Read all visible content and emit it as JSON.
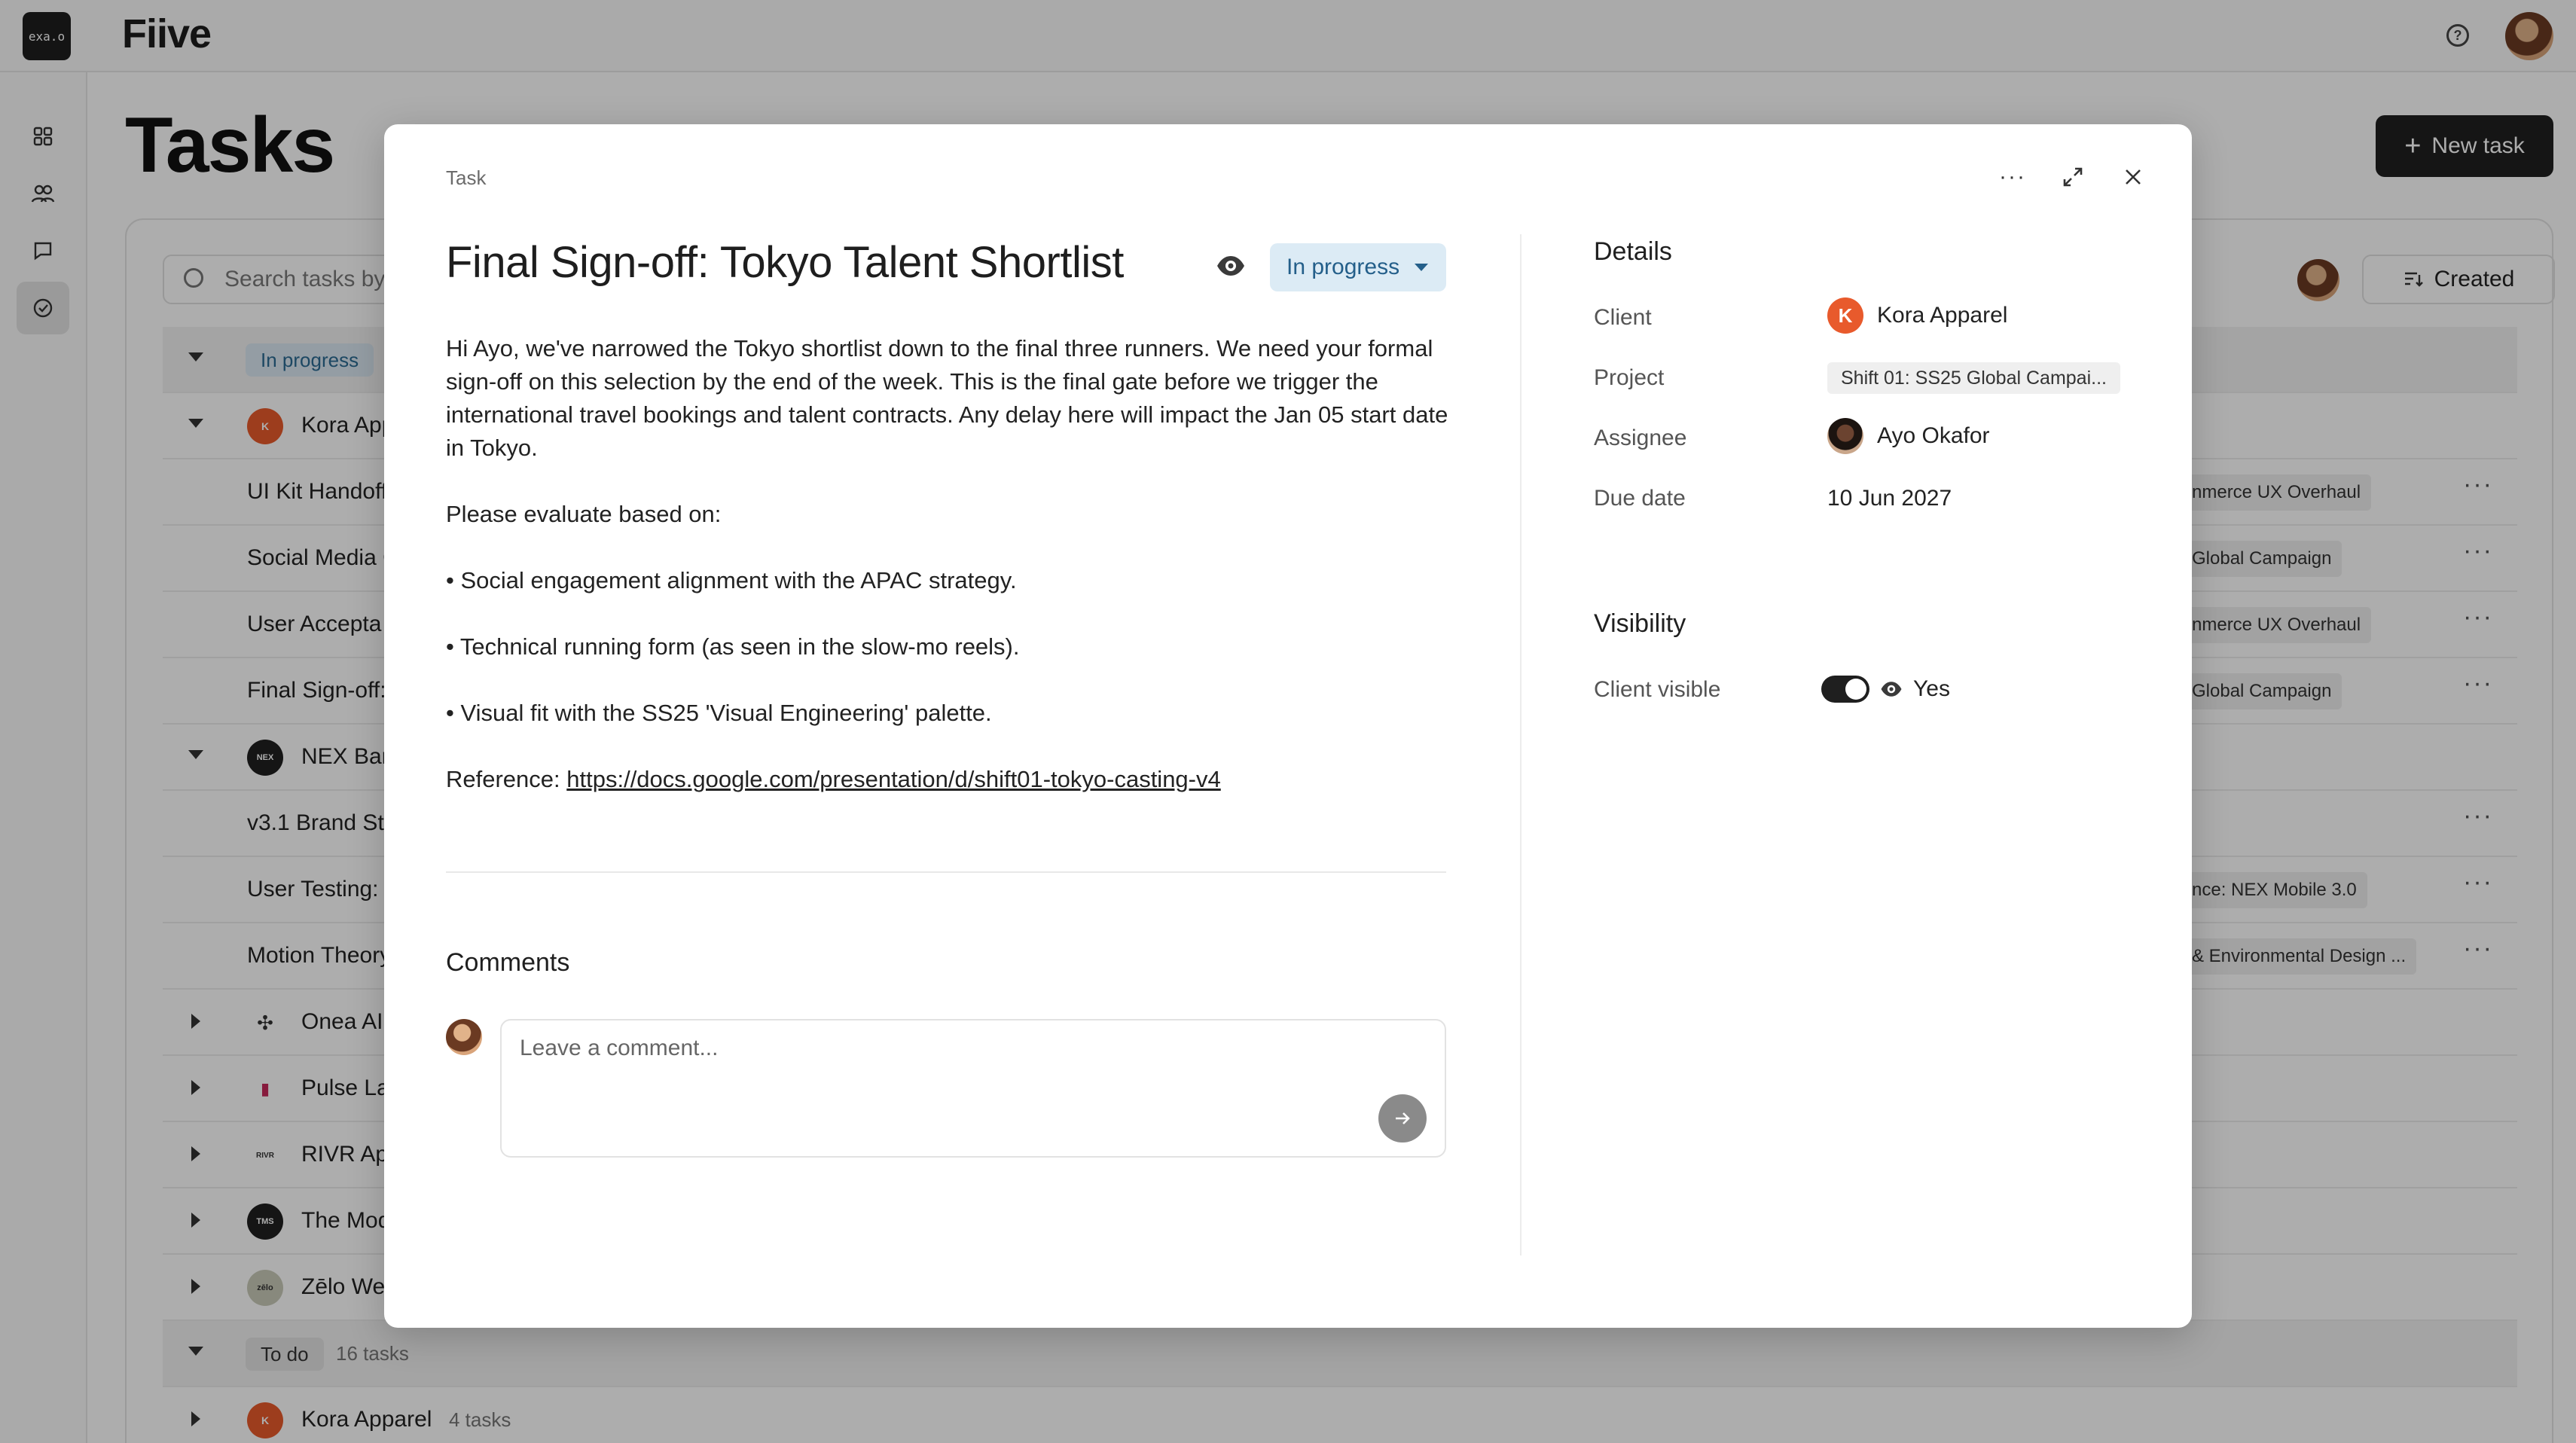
{
  "app": {
    "org_logo_text": "exa.o",
    "brand": "Fiive",
    "help_icon": "help-circle-icon"
  },
  "page": {
    "title": "Tasks",
    "new_task_label": "New task",
    "search_placeholder": "Search tasks by",
    "sort_label": "Created"
  },
  "list": {
    "groups": [
      {
        "status": "In progress"
      },
      {
        "status": "To do",
        "count": "16 tasks"
      }
    ],
    "rows": [
      {
        "kind": "client",
        "name": "Kora App",
        "logo": "K",
        "color": "#e85a2c"
      },
      {
        "kind": "task",
        "name": "UI Kit Handoff",
        "project": "nmerce UX Overhaul"
      },
      {
        "kind": "task",
        "name": "Social Media C",
        "project": "Global Campaign"
      },
      {
        "kind": "task",
        "name": "User Accepta",
        "project": "nmerce UX Overhaul"
      },
      {
        "kind": "task",
        "name": "Final Sign-off:",
        "project": "Global Campaign"
      },
      {
        "kind": "client",
        "name": "NEX Bar",
        "logo": "NEX",
        "color": "#1f1f1f"
      },
      {
        "kind": "task",
        "name": "v3.1 Brand Sty",
        "project": ""
      },
      {
        "kind": "task",
        "name": "User Testing:",
        "project": "nce: NEX Mobile 3.0"
      },
      {
        "kind": "task",
        "name": "Motion Theory",
        "project": "& Environmental Design ..."
      },
      {
        "kind": "client",
        "name": "Onea AI",
        "logo": "✣",
        "color": "#ffffff"
      },
      {
        "kind": "client",
        "name": "Pulse La",
        "logo": "▮",
        "color": "#ffffff"
      },
      {
        "kind": "client",
        "name": "RIVR Ap",
        "logo": "RIVR",
        "color": "#ffffff"
      },
      {
        "kind": "client",
        "name": "The Mod",
        "logo": "TMS",
        "color": "#1f1f1f"
      },
      {
        "kind": "client",
        "name": "Zēlo We",
        "logo": "zēlo",
        "color": "#c9cbb8"
      }
    ],
    "todo_first": {
      "name": "Kora Apparel",
      "logo": "K",
      "count": "4 tasks"
    }
  },
  "modal": {
    "kicker": "Task",
    "title": "Final Sign-off: Tokyo Talent Shortlist",
    "status": "In progress",
    "status_color": "#dcebf5",
    "description": {
      "intro": "Hi Ayo, we've narrowed the Tokyo shortlist down to the final three runners. We need your formal sign-off on this selection by the end of the week. This is the final gate before we trigger the international travel bookings and talent contracts. Any delay here will impact the Jan 05 start date in Tokyo.",
      "lead": "Please evaluate based on:",
      "bullets": [
        "• Social engagement alignment with the APAC strategy.",
        "• Technical running form (as seen in the slow-mo reels).",
        "• Visual fit with the SS25 'Visual Engineering' palette."
      ],
      "reference_label": "Reference: ",
      "reference_url": "https://docs.google.com/presentation/d/shift01-tokyo-casting-v4"
    },
    "comments": {
      "heading": "Comments",
      "placeholder": "Leave a comment..."
    },
    "details": {
      "heading": "Details",
      "client_label": "Client",
      "client_value": "Kora Apparel",
      "client_logo": "K",
      "project_label": "Project",
      "project_value": "Shift 01: SS25 Global Campai...",
      "assignee_label": "Assignee",
      "assignee_value": "Ayo Okafor",
      "due_label": "Due date",
      "due_value": "10 Jun 2027"
    },
    "visibility": {
      "heading": "Visibility",
      "client_visible_label": "Client visible",
      "client_visible_value": "Yes",
      "toggle_on": true
    }
  }
}
